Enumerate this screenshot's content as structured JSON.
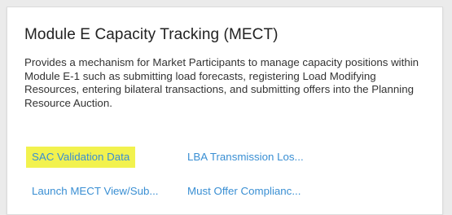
{
  "card": {
    "title": "Module E Capacity Tracking (MECT)",
    "description": "Provides a mechanism for Market Participants to manage capacity positions within Module E-1 such as submitting load forecasts, registering Load Modifying Resources, entering bilateral transactions, and submitting offers into the Planning Resource Auction.",
    "links": [
      {
        "label": "SAC Validation Data",
        "highlighted": true
      },
      {
        "label": "LBA Transmission Los..."
      },
      {
        "label": "Launch MECT View/Sub..."
      },
      {
        "label": "Must Offer Complianc..."
      }
    ]
  },
  "colors": {
    "link": "#3a8fd3",
    "highlight": "#f2f24e",
    "title": "#222222",
    "background": "#ebebeb",
    "card": "#ffffff"
  }
}
